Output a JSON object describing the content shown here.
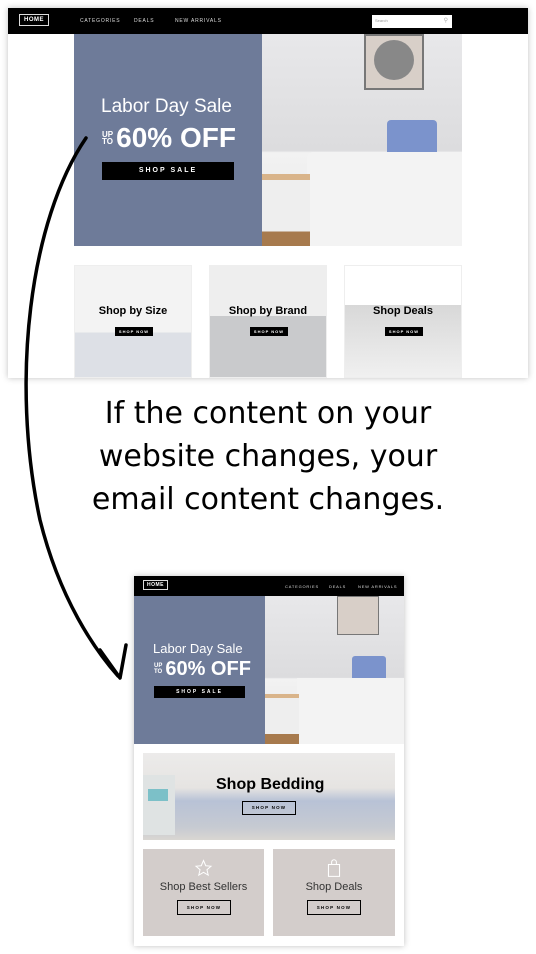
{
  "website": {
    "nav": {
      "home": "HOME",
      "links": [
        "CATEGORIES",
        "DEALS",
        "NEW ARRIVALS"
      ],
      "search_placeholder": "Search"
    },
    "hero": {
      "title": "Labor Day Sale",
      "up_to": [
        "UP",
        "TO"
      ],
      "offer": "60% OFF",
      "button": "SHOP SALE"
    },
    "cards": [
      {
        "title": "Shop by Size",
        "button": "SHOP NOW"
      },
      {
        "title": "Shop by Brand",
        "button": "SHOP NOW"
      },
      {
        "title": "Shop Deals",
        "button": "SHOP NOW"
      }
    ]
  },
  "caption": [
    "If the content on your",
    "website changes, your",
    "email content changes."
  ],
  "email": {
    "nav": {
      "home": "HOME",
      "links": [
        "CATEGORIES",
        "DEALS",
        "NEW ARRIVALS"
      ]
    },
    "hero": {
      "title": "Labor Day Sale",
      "up_to": [
        "UP",
        "TO"
      ],
      "offer": "60% OFF",
      "button": "SHOP SALE"
    },
    "bedding": {
      "title": "Shop Bedding",
      "button": "SHOP NOW"
    },
    "boxes": [
      {
        "title": "Shop Best Sellers",
        "button": "SHOP NOW",
        "icon": "star-icon"
      },
      {
        "title": "Shop Deals",
        "button": "SHOP NOW",
        "icon": "shopping-bag-icon"
      }
    ]
  },
  "colors": {
    "hero_blue": "#6e7b99",
    "box_grey": "#d3cdcb"
  }
}
